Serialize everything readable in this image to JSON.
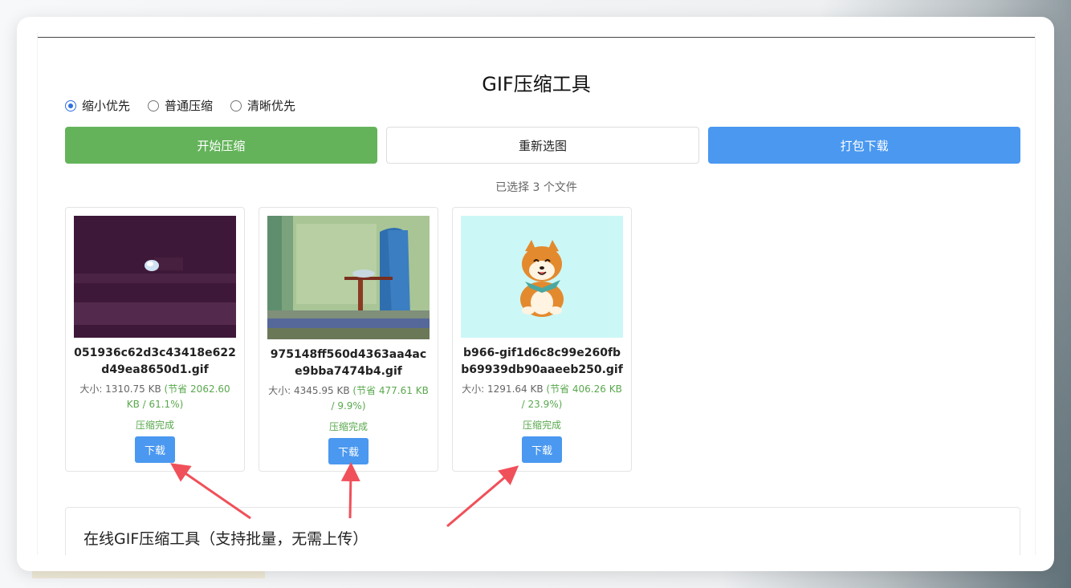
{
  "page": {
    "title": "GIF压缩工具",
    "selected_count_text": "已选择 3 个文件"
  },
  "modes": [
    {
      "label": "缩小优先",
      "selected": true
    },
    {
      "label": "普通压缩",
      "selected": false
    },
    {
      "label": "清晰优先",
      "selected": false
    }
  ],
  "buttons": {
    "start": "开始压缩",
    "reselect": "重新选图",
    "pack_download": "打包下载"
  },
  "files": [
    {
      "name": "051936c62d3c43418e622d49ea8650d1.gif",
      "size_label": "大小: 1310.75 KB",
      "saved_label": "(节省 2062.60 KB / 61.1%)",
      "status": "压缩完成",
      "download_label": "下载"
    },
    {
      "name": "975148ff560d4363aa4ace9bba7474b4.gif",
      "size_label": "大小: 4345.95 KB",
      "saved_label": "(节省 477.61 KB / 9.9%)",
      "status": "压缩完成",
      "download_label": "下载"
    },
    {
      "name": "b966-gif1d6c8c99e260fbb69939db90aaeeb250.gif",
      "size_label": "大小: 1291.64 KB",
      "saved_label": "(节省 406.26 KB / 23.9%)",
      "status": "压缩完成",
      "download_label": "下载"
    }
  ],
  "info": {
    "title": "在线GIF压缩工具（支持批量，无需上传）"
  },
  "colors": {
    "green": "#64b35a",
    "blue": "#4a98f0",
    "arrow": "#f0505a"
  }
}
